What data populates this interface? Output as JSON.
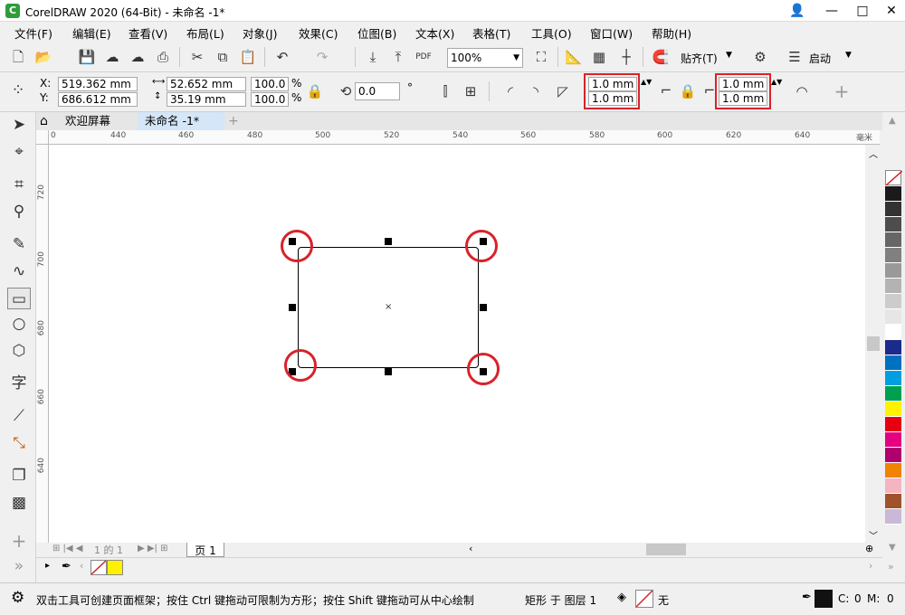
{
  "window": {
    "title": "CorelDRAW 2020 (64-Bit) - 未命名 -1*",
    "logo_glyph": "C"
  },
  "menu": [
    "文件(F)",
    "编辑(E)",
    "查看(V)",
    "布局(L)",
    "对象(J)",
    "效果(C)",
    "位图(B)",
    "文本(X)",
    "表格(T)",
    "工具(O)",
    "窗口(W)",
    "帮助(H)"
  ],
  "toolbar": {
    "zoom": "100%",
    "snap_label": "贴齐(T)",
    "launch_label": "启动"
  },
  "properties": {
    "x_label": "X:",
    "y_label": "Y:",
    "x": "519.362 mm",
    "y": "686.612 mm",
    "width": "52.652 mm",
    "height": "35.19 mm",
    "scale_x": "100.0",
    "scale_y": "100.0",
    "percent": "%",
    "rotation": "0.0",
    "rotation_unit": "°",
    "corner_tl": "1.0 mm",
    "corner_bl": "1.0 mm",
    "corner_tr": "1.0 mm",
    "corner_br": "1.0 mm"
  },
  "tabs": {
    "welcome": "欢迎屏幕",
    "document": "未命名 -1*"
  },
  "ruler": {
    "h_ticks": [
      "0",
      "440",
      "460",
      "480",
      "500",
      "520",
      "540",
      "560",
      "580",
      "600",
      "620",
      "640"
    ],
    "v_ticks": [
      "720",
      "700",
      "680",
      "660",
      "640"
    ],
    "unit": "毫米"
  },
  "pagebar": {
    "counter": "1 的 1",
    "page_tab": "页 1"
  },
  "status": {
    "hint": "双击工具可创建页面框架；按住 Ctrl 键拖动可限制为方形；按住 Shift 键拖动可从中心绘制",
    "object": "矩形 于 图层 1",
    "fill": "无",
    "c_label": "C:",
    "c_val": "0",
    "m_label": "M:",
    "m_val": "0"
  },
  "palette_colors": [
    "#1a1a1a",
    "#333333",
    "#4d4d4d",
    "#666666",
    "#808080",
    "#999999",
    "#b3b3b3",
    "#cccccc",
    "#e6e6e6",
    "#ffffff",
    "#1c2a8c",
    "#0070c0",
    "#00a0e0",
    "#00a050",
    "#fff200",
    "#e60012",
    "#e4007f",
    "#b0006e",
    "#f08300",
    "#f5b5c0",
    "#a0522d",
    "#c9b8d8"
  ],
  "colors": {
    "highlight": "#d8232a",
    "tab_active": "#d4e6f7"
  }
}
